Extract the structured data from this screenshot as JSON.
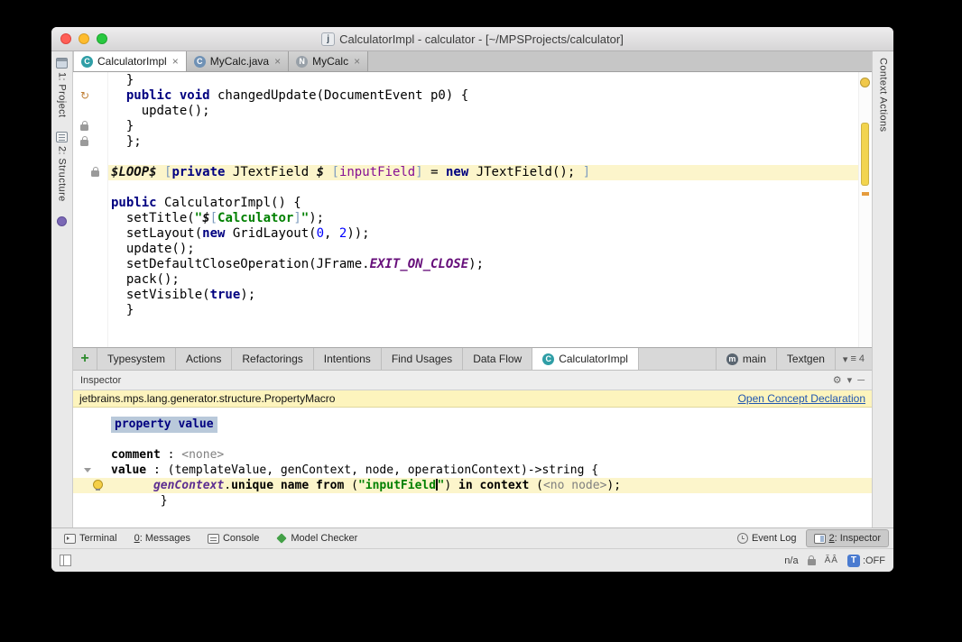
{
  "window": {
    "title": "CalculatorImpl - calculator - [~/MPSProjects/calculator]",
    "icon_letter": "j"
  },
  "glyphs": {
    "plus": "+",
    "close": "×",
    "gear": "⚙",
    "chevron_down": "▾",
    "hide_bar": "─",
    "menu": "≡",
    "override_arrow": "↻"
  },
  "editor_tabs": [
    {
      "label": "CalculatorImpl",
      "active": true,
      "icon_name": "concept-icon",
      "icon_letter": "C",
      "icon_bg": "#2f9ea6"
    },
    {
      "label": "MyCalc.java",
      "active": false,
      "icon_name": "java-class-icon",
      "icon_letter": "C",
      "icon_bg": "#6f91b5"
    },
    {
      "label": "MyCalc",
      "active": false,
      "icon_name": "node-icon",
      "icon_letter": "N",
      "icon_bg": "#98a0a8"
    }
  ],
  "tool_stripes": {
    "left": [
      {
        "label": "1: Project",
        "icon": "project-icon"
      },
      {
        "label": "2: Structure",
        "icon": "structure-icon"
      },
      {
        "label": "",
        "icon": "purple-tool-icon"
      }
    ],
    "right": [
      {
        "label": "Context Actions",
        "icon": null
      }
    ]
  },
  "editor": {
    "lines": [
      {
        "ind": 2,
        "tk": [
          [
            "}",
            "p"
          ]
        ]
      },
      {
        "ind": 2,
        "tk": [
          [
            "public void",
            "kw"
          ],
          [
            " changedUpdate(DocumentEvent p0) {",
            "p"
          ]
        ]
      },
      {
        "ind": 4,
        "tk": [
          [
            "update();",
            "p"
          ]
        ]
      },
      {
        "ind": 2,
        "tk": [
          [
            "}",
            "p"
          ]
        ]
      },
      {
        "ind": 2,
        "tk": [
          [
            "};",
            "p"
          ]
        ]
      },
      {
        "ind": 0,
        "tk": []
      },
      {
        "ind": 0,
        "hl": true,
        "tk": [
          [
            "$LOOP$",
            "macro"
          ],
          [
            " ",
            "p"
          ],
          [
            "[",
            "br"
          ],
          [
            "private",
            "kw"
          ],
          [
            " JTextField ",
            "p"
          ],
          [
            "$",
            "macro"
          ],
          [
            " ",
            "p"
          ],
          [
            "[",
            "br"
          ],
          [
            "inputField",
            "field"
          ],
          [
            "]",
            "br"
          ],
          [
            " = ",
            "p"
          ],
          [
            "new",
            "kw"
          ],
          [
            " JTextField();",
            "p"
          ],
          [
            " ]",
            "br"
          ]
        ]
      },
      {
        "ind": 0,
        "tk": []
      },
      {
        "ind": 0,
        "tk": [
          [
            "public",
            "kw"
          ],
          [
            " CalculatorImpl() {",
            "p"
          ]
        ]
      },
      {
        "ind": 2,
        "tk": [
          [
            "setTitle(",
            "p"
          ],
          [
            "\"",
            "str"
          ],
          [
            "$",
            "macro"
          ],
          [
            "[",
            "br"
          ],
          [
            "Calculator",
            "str"
          ],
          [
            "]",
            "br"
          ],
          [
            "\"",
            "str"
          ],
          [
            ");",
            "p"
          ]
        ]
      },
      {
        "ind": 2,
        "tk": [
          [
            "setLayout(",
            "p"
          ],
          [
            "new",
            "kw"
          ],
          [
            " GridLayout(",
            "p"
          ],
          [
            "0",
            "num"
          ],
          [
            ", ",
            "p"
          ],
          [
            "2",
            "num"
          ],
          [
            "));",
            "p"
          ]
        ]
      },
      {
        "ind": 2,
        "tk": [
          [
            "update();",
            "p"
          ]
        ]
      },
      {
        "ind": 2,
        "tk": [
          [
            "setDefaultCloseOperation(JFrame.",
            "p"
          ],
          [
            "EXIT_ON_CLOSE",
            "static"
          ],
          [
            ");",
            "p"
          ]
        ]
      },
      {
        "ind": 2,
        "tk": [
          [
            "pack();",
            "p"
          ]
        ]
      },
      {
        "ind": 2,
        "tk": [
          [
            "setVisible(",
            "p"
          ],
          [
            "true",
            "kw"
          ],
          [
            ");",
            "p"
          ]
        ]
      },
      {
        "ind": 2,
        "tk": [
          [
            "}",
            "p"
          ]
        ]
      }
    ],
    "gutter_icons": [
      {
        "line": 1,
        "type": "override"
      },
      {
        "line": 3,
        "type": "lock"
      },
      {
        "line": 4,
        "type": "lock"
      },
      {
        "line": 6,
        "type": "lock",
        "x": 20
      }
    ]
  },
  "aspect_tabs": {
    "tabs": [
      {
        "label": "Typesystem"
      },
      {
        "label": "Actions"
      },
      {
        "label": "Refactorings"
      },
      {
        "label": "Intentions"
      },
      {
        "label": "Find Usages"
      },
      {
        "label": "Data Flow"
      },
      {
        "label": "CalculatorImpl",
        "active": true,
        "icon_name": "concept-icon",
        "icon_letter": "C",
        "icon_bg": "#2f9ea6"
      },
      {
        "label": "main",
        "push_right": true,
        "icon_name": "generator-icon",
        "icon_letter": "m",
        "icon_bg": "#5a6570"
      },
      {
        "label": "Textgen"
      }
    ],
    "overflow_count": "4"
  },
  "inspector": {
    "title": "Inspector",
    "concept": "jetbrains.mps.lang.generator.structure.PropertyMacro",
    "link": "Open Concept Declaration",
    "lines": [
      {
        "ind": 0,
        "sel": true,
        "tk": [
          [
            "property value",
            "kwsel"
          ]
        ]
      },
      {
        "ind": 0,
        "tk": []
      },
      {
        "ind": 0,
        "tk": [
          [
            "comment",
            "b"
          ],
          [
            " : ",
            "p"
          ],
          [
            "<none>",
            "gray"
          ]
        ]
      },
      {
        "ind": 0,
        "fold": true,
        "tk": [
          [
            "value",
            "b"
          ],
          [
            " : ",
            "p"
          ],
          [
            "(templateValue, genContext, node, operationContext)->string {",
            "p"
          ]
        ]
      },
      {
        "ind": 6,
        "hl": true,
        "bulb": true,
        "tk": [
          [
            "genContext",
            "param"
          ],
          [
            ".",
            "p"
          ],
          [
            "unique name from",
            "b"
          ],
          [
            " (",
            "p"
          ],
          [
            "\"inputField",
            "str"
          ],
          [
            "",
            "caret"
          ],
          [
            "\"",
            "str"
          ],
          [
            ") ",
            "p"
          ],
          [
            "in context",
            "b"
          ],
          [
            " (",
            "p"
          ],
          [
            "<no node>",
            "gray"
          ],
          [
            ");",
            "p"
          ]
        ]
      },
      {
        "ind": 7,
        "tk": [
          [
            "}",
            "p"
          ]
        ]
      }
    ]
  },
  "toolbar": {
    "left": [
      {
        "label": "Terminal",
        "icon": "terminal-icon"
      },
      {
        "label": "0: Messages",
        "mnemonic": "0"
      },
      {
        "label": "Console",
        "icon": "console-icon"
      },
      {
        "label": "Model Checker",
        "icon": "model-checker-icon"
      }
    ],
    "right": [
      {
        "label": "Event Log",
        "icon": "event-log-icon"
      },
      {
        "label": "2: Inspector",
        "icon": "inspector-icon",
        "mnemonic": "2",
        "active": true
      }
    ]
  },
  "statusbar": {
    "position": "n/a",
    "assist_glyphs": "ĂÂ",
    "t_badge": "T",
    "t_state": ":OFF"
  }
}
